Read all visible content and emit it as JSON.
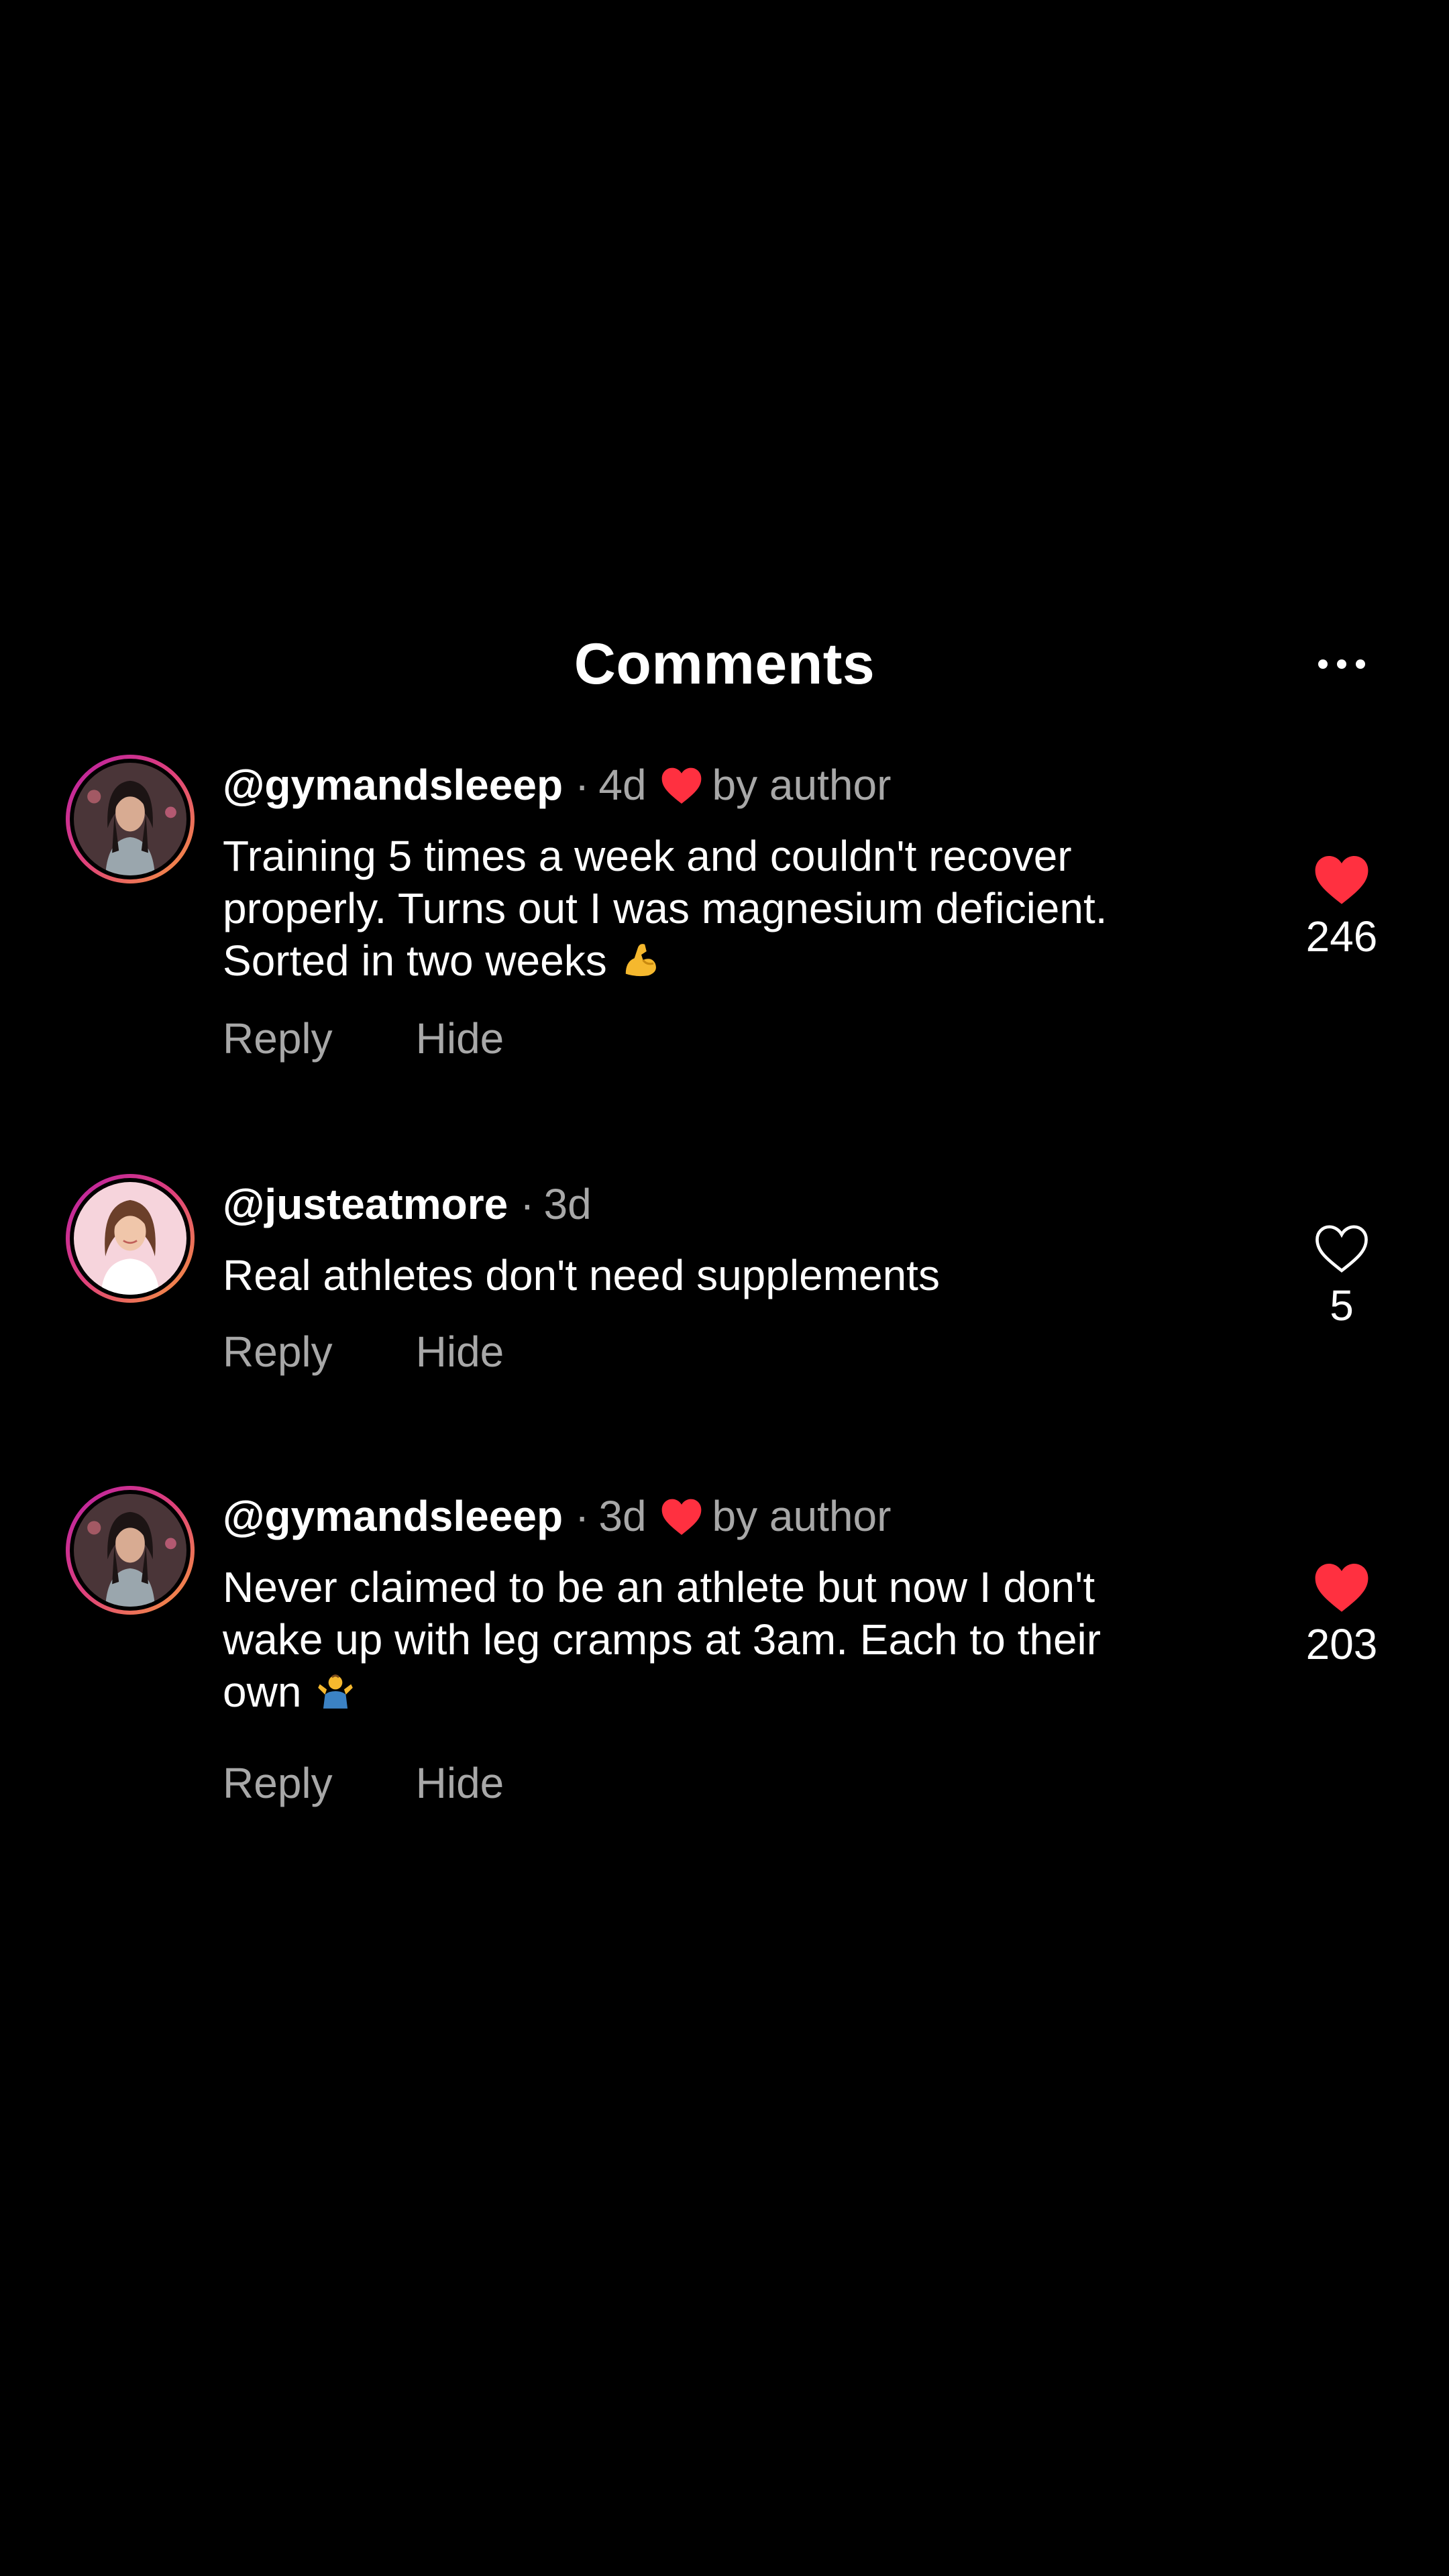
{
  "header": {
    "title": "Comments",
    "more_icon": "more-horizontal-icon"
  },
  "colors": {
    "background": "#000000",
    "text_primary": "#ffffff",
    "text_secondary": "#a8a8a8",
    "like_active": "#ff3040",
    "avatar_ring": [
      "#b81ea6",
      "#e0427a",
      "#f79b3a"
    ]
  },
  "comments": [
    {
      "username": "@gymandsleeep",
      "separator": "·",
      "time": "4d",
      "author_liked": true,
      "by_author": "by author",
      "text": "Training 5 times a week and couldn't recover properly. Turns out I was magnesium deficient. Sorted in two weeks",
      "emoji": "flexed-biceps-emoji",
      "reply_label": "Reply",
      "hide_label": "Hide",
      "liked": true,
      "like_count": "246"
    },
    {
      "username": "@justeatmore",
      "separator": "·",
      "time": "3d",
      "author_liked": false,
      "text": "Real athletes don't need supplements",
      "reply_label": "Reply",
      "hide_label": "Hide",
      "liked": false,
      "like_count": "5"
    },
    {
      "username": "@gymandsleeep",
      "separator": "·",
      "time": "3d",
      "author_liked": true,
      "by_author": "by author",
      "text": "Never claimed to be an athlete but now I don't wake up with leg cramps at 3am. Each to their own",
      "emoji": "person-shrugging-emoji",
      "reply_label": "Reply",
      "hide_label": "Hide",
      "liked": true,
      "like_count": "203"
    }
  ]
}
